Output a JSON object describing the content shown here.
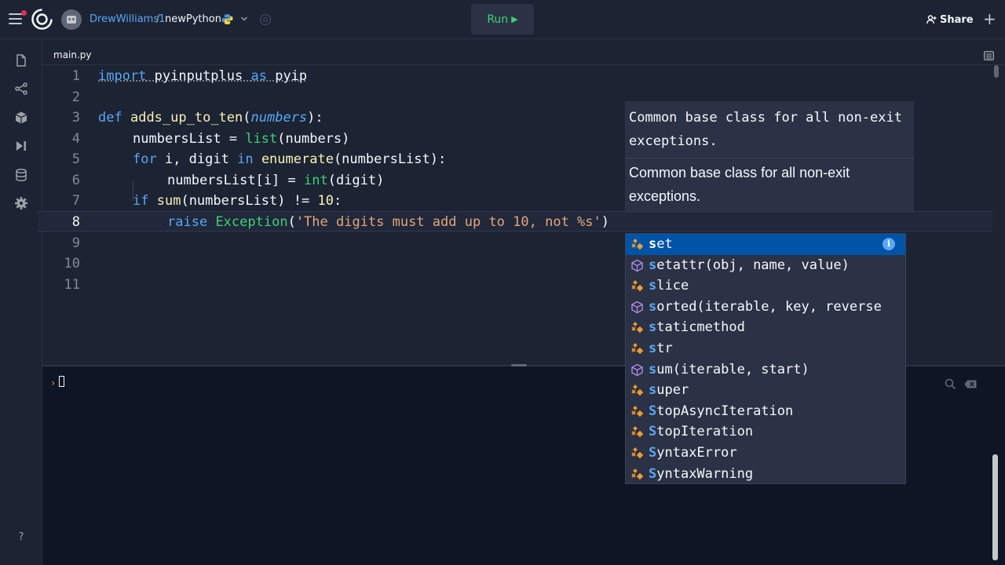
{
  "topbar": {
    "username": "DrewWilliams1",
    "separator": "/",
    "repl_name": "newPython",
    "run_label": "Run",
    "run_glyph": "▶",
    "share_label": "Share",
    "plus_glyph": "+"
  },
  "editor": {
    "tab_name": "main.py",
    "lines": [
      {
        "n": "1"
      },
      {
        "n": "2"
      },
      {
        "n": "3"
      },
      {
        "n": "4"
      },
      {
        "n": "5"
      },
      {
        "n": "6"
      },
      {
        "n": "7"
      },
      {
        "n": "8"
      },
      {
        "n": "9"
      },
      {
        "n": "10"
      },
      {
        "n": "11"
      }
    ],
    "tokens": {
      "l1": [
        "import",
        " pyinputplus ",
        "as",
        " pyip"
      ],
      "l3": [
        "def",
        " ",
        "adds_up_to_ten",
        "(",
        "numbers",
        "):"
      ],
      "l4": [
        "numbersList",
        " = ",
        "list",
        "(numbers)"
      ],
      "l5": [
        "for",
        " i, digit ",
        "in",
        " ",
        "enumerate",
        "(numbersList):"
      ],
      "l6": [
        "numbersList[i] = ",
        "int",
        "(digit)"
      ],
      "l7": [
        "if",
        " ",
        "sum",
        "(numbersList) != ",
        "10",
        ":"
      ],
      "l8": [
        "raise",
        " ",
        "Exception",
        "(",
        "'The digits must add up to 10, not %s'",
        ")"
      ]
    }
  },
  "hover_doc": {
    "signature": "Common base class for all non-exit exceptions.",
    "description": "Common base class for all non-exit exceptions."
  },
  "suggestions": [
    {
      "match": "s",
      "rest": "et",
      "kind": "class"
    },
    {
      "match": "s",
      "rest": "etattr(obj, name, value)",
      "kind": "function"
    },
    {
      "match": "s",
      "rest": "lice",
      "kind": "class"
    },
    {
      "match": "s",
      "rest": "orted(iterable, key, reverse",
      "kind": "function"
    },
    {
      "match": "s",
      "rest": "taticmethod",
      "kind": "class"
    },
    {
      "match": "s",
      "rest": "tr",
      "kind": "class"
    },
    {
      "match": "s",
      "rest": "um(iterable, start)",
      "kind": "function"
    },
    {
      "match": "s",
      "rest": "uper",
      "kind": "class"
    },
    {
      "match": "S",
      "rest": "topAsyncIteration",
      "kind": "class"
    },
    {
      "match": "S",
      "rest": "topIteration",
      "kind": "class"
    },
    {
      "match": "S",
      "rest": "yntaxError",
      "kind": "class"
    },
    {
      "match": "S",
      "rest": "yntaxWarning",
      "kind": "class"
    }
  ],
  "suggest_info_glyph": "i",
  "console": {
    "prompt": "›"
  },
  "sidebar": {
    "help_glyph": "?"
  },
  "colors": {
    "background": "#1c2333",
    "console_background": "#0e1525",
    "accent_blue": "#5ba7f5",
    "run_green": "#3ed174",
    "string_orange": "#e7a57b",
    "selected_suggestion": "#0053a6"
  }
}
